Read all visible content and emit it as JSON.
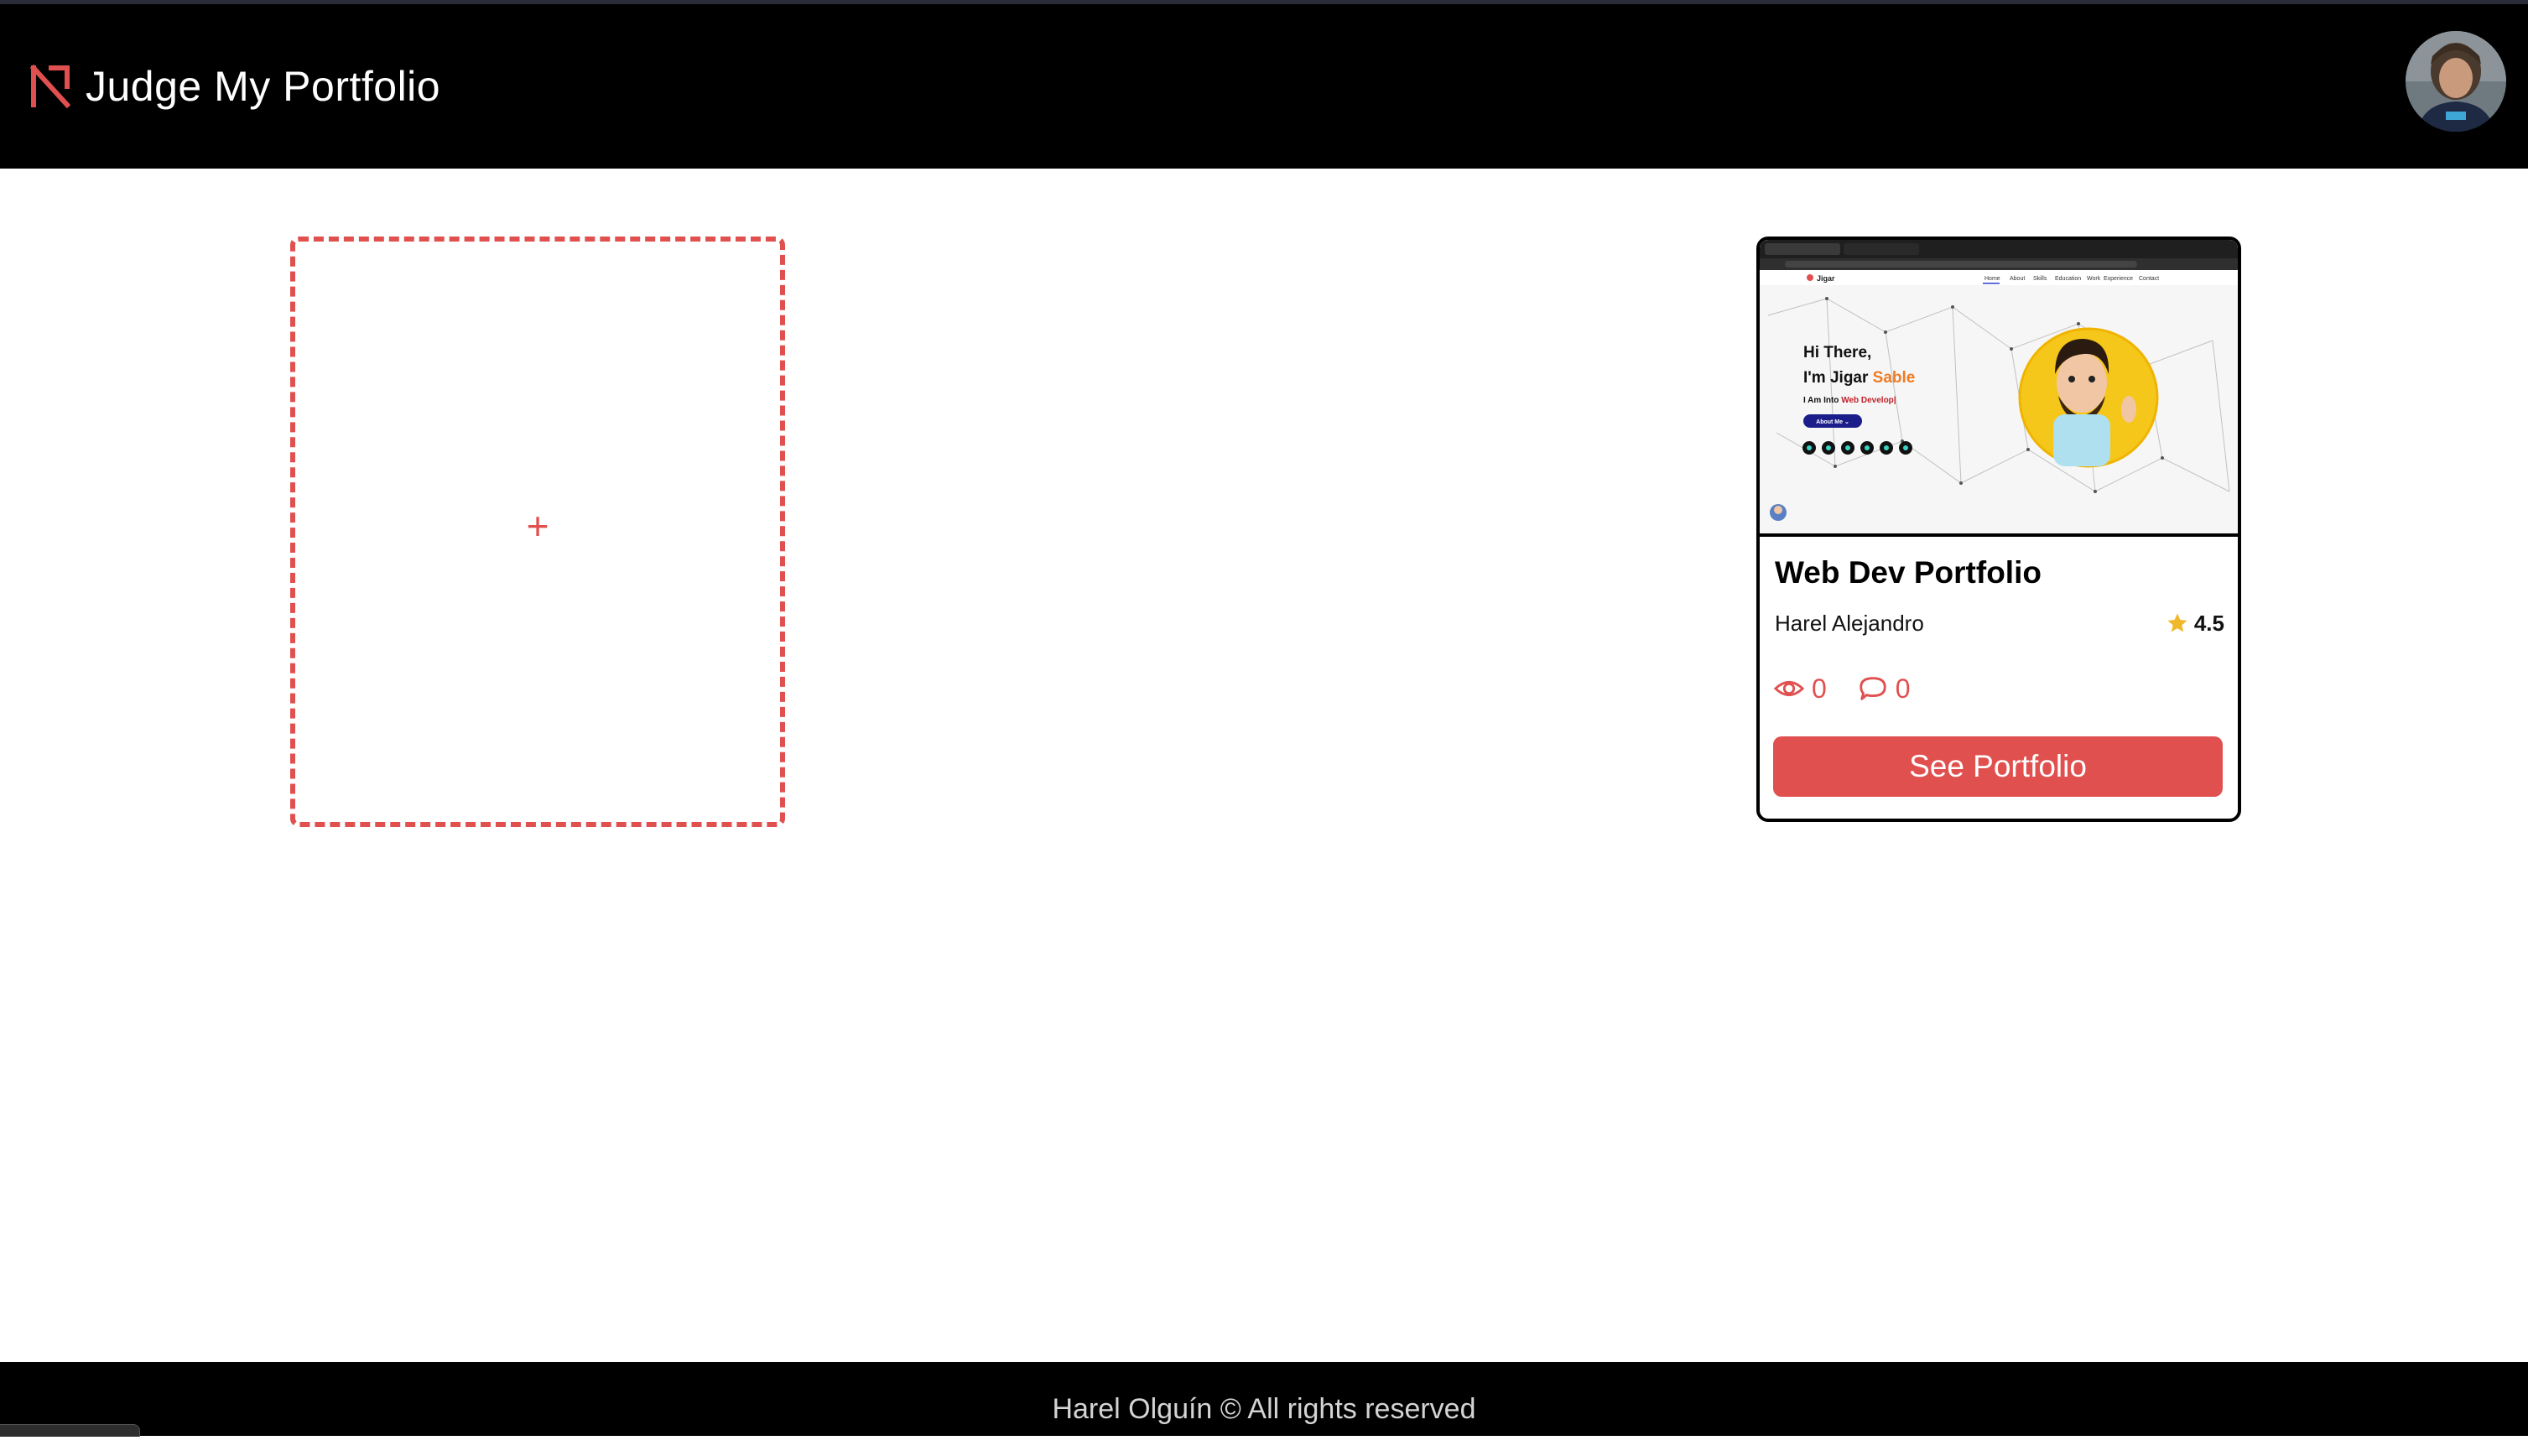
{
  "header": {
    "brand": "Judge My Portfolio",
    "logo_icon": "judge-my-portfolio-logo-icon",
    "avatar_icon": "user-avatar"
  },
  "add_card": {
    "icon": "+"
  },
  "portfolio_card": {
    "title": "Web Dev Portfolio",
    "author": "Harel Alejandro",
    "rating": "4.5",
    "views": "0",
    "comments": "0",
    "button_label": "See Portfolio",
    "thumbnail": {
      "heading_line1": "Hi There,",
      "heading_line2_prefix": "I'm Jigar ",
      "heading_line2_accent": "Sable",
      "subtitle_prefix": "I Am Into ",
      "subtitle_accent": "Web Develop|",
      "about_button": "About Me ⌄",
      "site_logo": "Jigar",
      "nav": [
        "Home",
        "About",
        "Skills",
        "Education",
        "Work",
        "Experience",
        "Contact"
      ]
    }
  },
  "footer": {
    "text": "Harel Olguín © All rights reserved"
  },
  "colors": {
    "accent": "#e0504f",
    "header_bg": "#000000",
    "star": "#f0b92c"
  }
}
